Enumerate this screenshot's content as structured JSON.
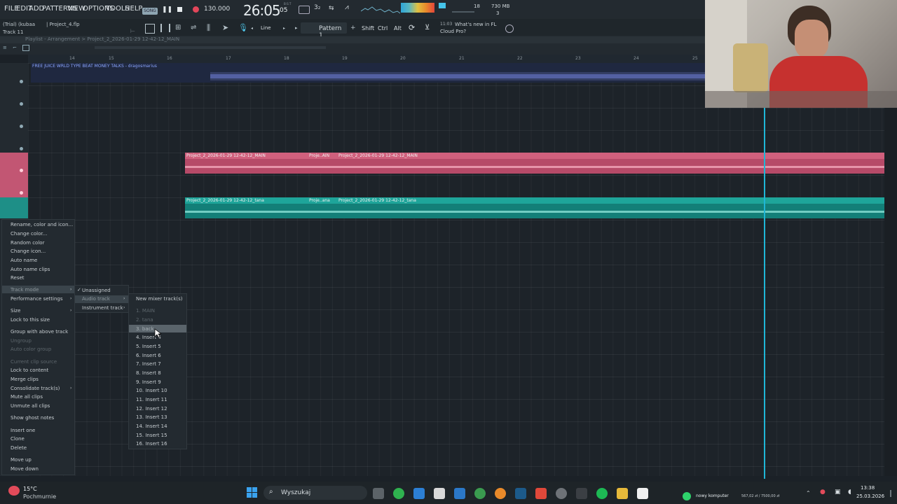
{
  "menubar": {
    "items": [
      "FILE",
      "EDIT",
      "ADD",
      "PATTERNS",
      "VIEW",
      "OPTIONS",
      "TOOLS",
      "HELP"
    ],
    "song_badge": "SONG",
    "tempo": "130.000",
    "time": "26:05",
    "time_small": "05",
    "time_label": "B:S:T",
    "cpu_value": "18",
    "mem": "730 MB",
    "mem_sub": "3"
  },
  "info": {
    "trial": "(Trial) (kubaa",
    "project": "| Project_4.flp",
    "hint": "Track 11",
    "pattern": "Pattern 1",
    "line_mode": "Line",
    "news_time": "11:03",
    "news_text": "What's new in FL",
    "news_text2": "Cloud Pro?",
    "keys": [
      "Shift",
      "Ctrl",
      "Alt"
    ]
  },
  "breadcrumb": "Playlist - Arrangement > Project_2_2026-01-29 12-42-12_MAIN",
  "ruler": {
    "marks": [
      "14",
      "15",
      "16",
      "17",
      "18",
      "19",
      "20",
      "21",
      "22",
      "23",
      "24",
      "25"
    ]
  },
  "playlist": {
    "top_clip": "FREE JUICE WRLD TYPE BEAT MONEY TALKS - dragosmarius",
    "pink_clip_1": "Project_2_2026-01-29 12-42-12_MAIN",
    "pink_clip_2": "Proje..AIN",
    "pink_clip_3": "Project_2_2026-01-29 12-42-12_MAIN",
    "teal_clip_1": "Project_2_2026-01-29 12-42-12_tana",
    "teal_clip_2": "Proje..ana",
    "teal_clip_3": "Project_2_2026-01-29 12-42-12_tana"
  },
  "context_menu": {
    "items": [
      {
        "label": "Rename, color and icon...",
        "dim": false
      },
      {
        "label": "Change color...",
        "dim": false
      },
      {
        "label": "Random color",
        "dim": false
      },
      {
        "label": "Change icon...",
        "dim": false
      },
      {
        "label": "Auto name",
        "dim": false
      },
      {
        "label": "Auto name clips",
        "dim": false
      },
      {
        "label": "Reset",
        "dim": false
      },
      {
        "label": "Track mode",
        "dim": false
      },
      {
        "label": "Performance settings",
        "dim": false
      },
      {
        "label": "Size",
        "dim": false
      },
      {
        "label": "Lock to this size",
        "dim": false
      },
      {
        "label": "Group with above track",
        "dim": false
      },
      {
        "label": "Ungroup",
        "dim": true
      },
      {
        "label": "Auto color group",
        "dim": true
      },
      {
        "label": "Current clip source",
        "dim": true
      },
      {
        "label": "Lock to content",
        "dim": false
      },
      {
        "label": "Merge clips",
        "dim": false
      },
      {
        "label": "Consolidate track(s)",
        "dim": false
      },
      {
        "label": "Mute all clips",
        "dim": false
      },
      {
        "label": "Unmute all clips",
        "dim": false
      },
      {
        "label": "Show ghost notes",
        "dim": false
      },
      {
        "label": "Insert one",
        "dim": false
      },
      {
        "label": "Clone",
        "dim": false
      },
      {
        "label": "Delete",
        "dim": false
      },
      {
        "label": "Move up",
        "dim": false
      },
      {
        "label": "Move down",
        "dim": false
      }
    ]
  },
  "track_mode_menu": {
    "items": [
      "Unassigned",
      "Audio track",
      "Instrument track"
    ]
  },
  "mixer_menu": {
    "header": "New mixer track(s)",
    "items": [
      {
        "label": "1. MAIN",
        "dim": true
      },
      {
        "label": "2. tana",
        "dim": true
      },
      {
        "label": "3. back",
        "dim": false
      },
      {
        "label": "4. Insert 4",
        "dim": false
      },
      {
        "label": "5. Insert 5",
        "dim": false
      },
      {
        "label": "6. Insert 6",
        "dim": false
      },
      {
        "label": "7. Insert 7",
        "dim": false
      },
      {
        "label": "8. Insert 8",
        "dim": false
      },
      {
        "label": "9. Insert 9",
        "dim": false
      },
      {
        "label": "10. Insert 10",
        "dim": false
      },
      {
        "label": "11. Insert 11",
        "dim": false
      },
      {
        "label": "12. Insert 12",
        "dim": false
      },
      {
        "label": "13. Insert 13",
        "dim": false
      },
      {
        "label": "14. Insert 14",
        "dim": false
      },
      {
        "label": "15. Insert 15",
        "dim": false
      },
      {
        "label": "16. Insert 16",
        "dim": false
      }
    ]
  },
  "taskbar": {
    "weather_temp": "15°C",
    "weather_desc": "Pochmurnie",
    "search_placeholder": "Wyszukaj",
    "notify_title": "nowy komputer",
    "notify_value": "567,02 zł / 7500,00 zł",
    "clock_time": "13:38",
    "clock_date": "25.03.2026"
  },
  "colors": {
    "pink": "#d0516f",
    "teal": "#1fa59a",
    "accent": "#19b5d6",
    "bg": "#1d2329"
  }
}
